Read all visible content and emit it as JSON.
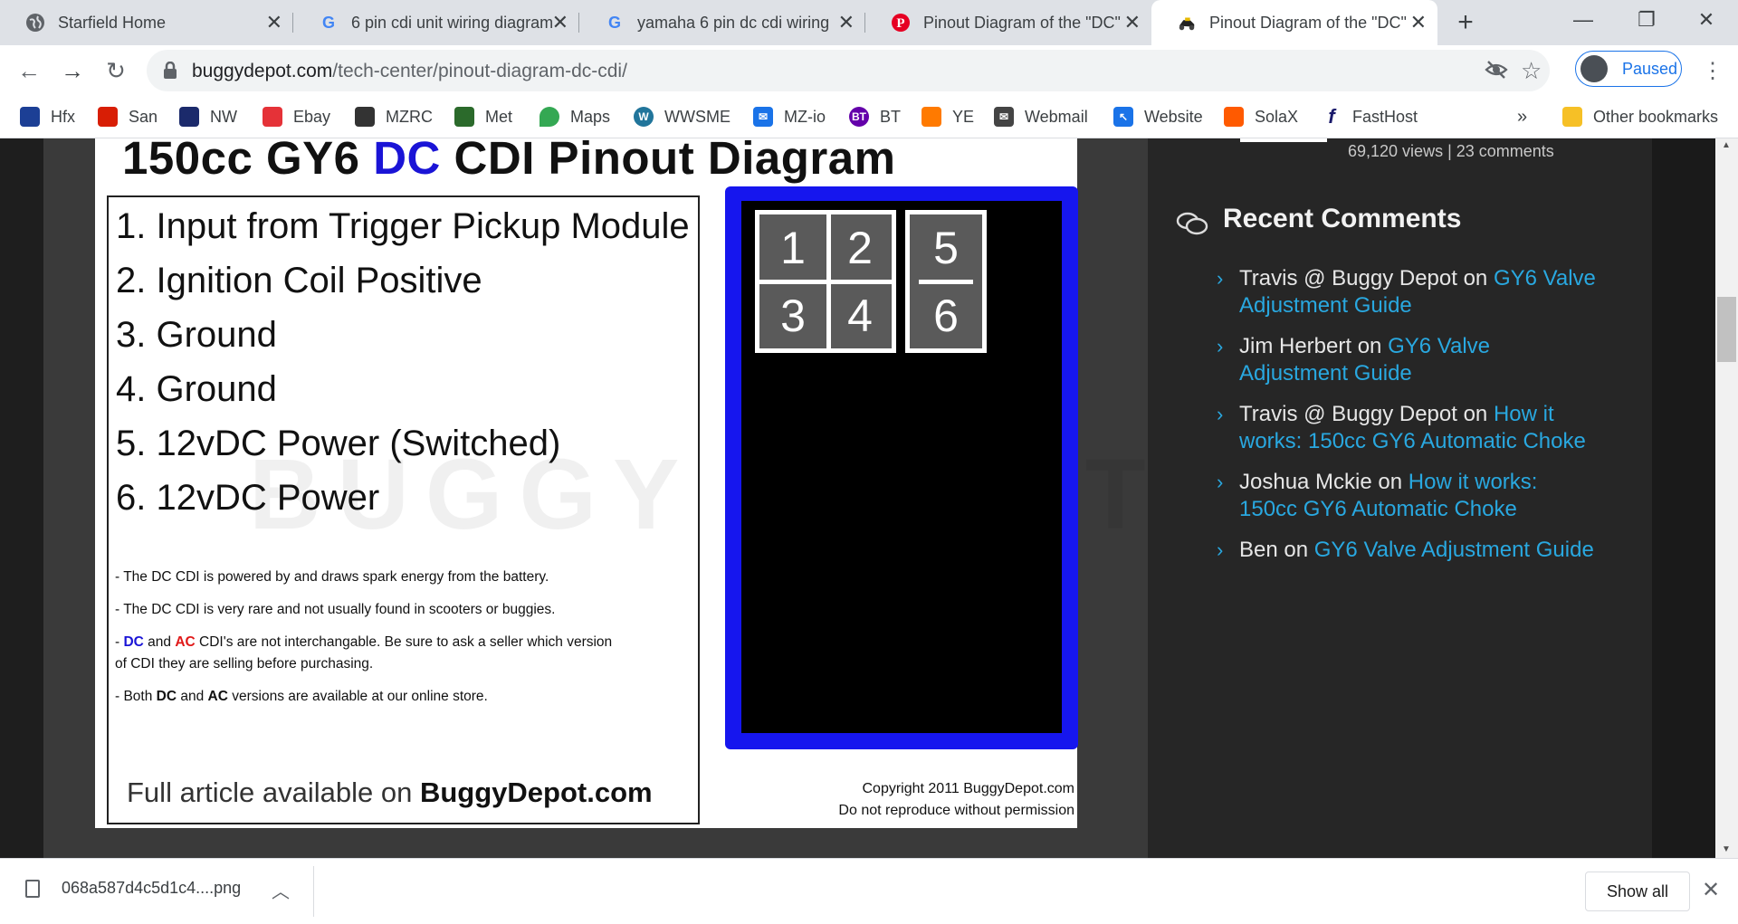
{
  "tabs": [
    {
      "title": "Starfield Home",
      "icon": "globe-icon"
    },
    {
      "title": "6 pin cdi unit wiring diagram",
      "icon": "google-icon"
    },
    {
      "title": "yamaha 6 pin dc cdi wiring",
      "icon": "google-icon"
    },
    {
      "title": "Pinout Diagram of the \"DC\"",
      "icon": "pinterest-icon"
    },
    {
      "title": "Pinout Diagram of the \"DC\"",
      "icon": "buggy-icon"
    }
  ],
  "active_tab_index": 4,
  "toolbar": {
    "url_host": "buggydepot.com",
    "url_path": "/tech-center/pinout-diagram-dc-cdi/",
    "profile_label": "Paused"
  },
  "bookmarks": [
    {
      "label": "Hfx",
      "color": "#1c3f95"
    },
    {
      "label": "San",
      "color": "#d81e05"
    },
    {
      "label": "NW",
      "color": "#1b2a6b"
    },
    {
      "label": "Ebay",
      "color": "#e53238"
    },
    {
      "label": "MZRC",
      "color": "#333333"
    },
    {
      "label": "Met",
      "color": "#2b6a2b"
    },
    {
      "label": "Maps",
      "color": "#34a853"
    },
    {
      "label": "WWSME",
      "color": "#21759b"
    },
    {
      "label": "MZ-io",
      "color": "#1a73e8"
    },
    {
      "label": "BT",
      "color": "#6400aa"
    },
    {
      "label": "YE",
      "color": "#ff7a00"
    },
    {
      "label": "Webmail",
      "color": "#444444"
    },
    {
      "label": "Website",
      "color": "#1a73e8"
    },
    {
      "label": "SolaX",
      "color": "#ff5a00"
    },
    {
      "label": "FastHost",
      "color": "#1a1a6b"
    }
  ],
  "bookmarks_overflow": "»",
  "other_bookmarks": "Other bookmarks",
  "diagram": {
    "title_pre": "150cc GY6 ",
    "title_dc": "DC",
    "title_post": " CDI Pinout Diagram",
    "pins": [
      "1. Input from Trigger Pickup Module",
      "2. Ignition Coil Positive",
      "3. Ground",
      "4. Ground",
      "5. 12vDC Power (Switched)",
      "6. 12vDC Power"
    ],
    "notes": {
      "n1": "- The DC CDI is powered by and draws spark energy from the battery.",
      "n2": "- The DC CDI is very rare and not usually found in scooters or buggies.",
      "n3_pre": "- ",
      "n3_dc": "DC",
      "n3_and": " and ",
      "n3_ac": "AC",
      "n3_post": " CDI's are not interchangable. Be sure to ask a seller which version",
      "n3_line2": "of CDI they are selling before purchasing.",
      "n4_pre": "- Both ",
      "n4_dc": "DC",
      "n4_and": " and ",
      "n4_ac": "AC",
      "n4_post": " versions are available at our online store."
    },
    "full_article_pre": "Full article available on ",
    "full_article_site": "BuggyDepot.com",
    "connector_pins": [
      "1",
      "2",
      "3",
      "4",
      "5",
      "6"
    ],
    "copyright_line1": "Copyright 2011 BuggyDepot.com",
    "copyright_line2": "Do not reproduce without permission",
    "watermark": "BUGGY DEPOT",
    "colors": {
      "dc_blue": "#1a14d6",
      "ac_red": "#e01818",
      "connector_border": "#1616ee"
    }
  },
  "sidebar": {
    "stats": "69,120 views | 23 comments",
    "recent_comments_title": "Recent Comments",
    "comments": [
      {
        "author": "Travis @ Buggy Depot",
        "on": "on",
        "post": "GY6 Valve Adjustment Guide"
      },
      {
        "author": "Jim Herbert",
        "on": "on",
        "post": "GY6 Valve Adjustment Guide"
      },
      {
        "author": "Travis @ Buggy Depot",
        "on": "on",
        "post": "How it works: 150cc GY6 Automatic Choke"
      },
      {
        "author": "Joshua Mckie",
        "on": "on",
        "post": "How it works: 150cc GY6 Automatic Choke"
      },
      {
        "author": "Ben",
        "on": "on",
        "post": "GY6 Valve Adjustment Guide"
      }
    ],
    "link_color": "#29a8e0"
  },
  "download": {
    "filename": "068a587d4c5d1c4....png",
    "show_all": "Show all"
  }
}
